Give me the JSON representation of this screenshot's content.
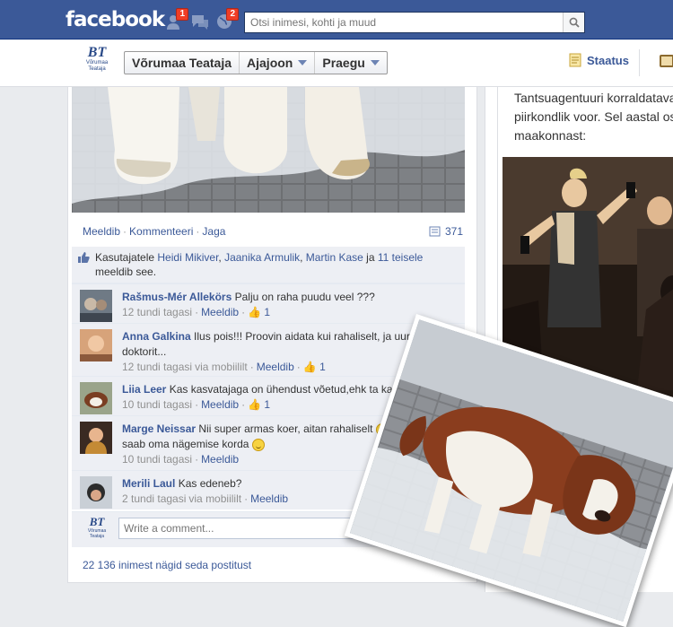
{
  "topbar": {
    "logo": "facebook",
    "friend_requests_badge": "1",
    "messages_badge": "",
    "notifications_badge": "2",
    "search_placeholder": "Otsi inimesi, kohti ja muud"
  },
  "page_header": {
    "logo_monogram": "BT",
    "logo_caption": "Võrumaa Teataja",
    "crumbs": [
      {
        "label": "Võrumaa Teataja"
      },
      {
        "label": "Ajajoon"
      },
      {
        "label": "Praegu"
      }
    ],
    "status_label": "Staatus"
  },
  "post": {
    "actions": {
      "like": "Meeldib",
      "comment": "Kommenteeri",
      "share": "Jaga",
      "share_count": "371"
    },
    "likes": {
      "prefix": "Kasutajatele",
      "names": [
        "Heidi Mikiver",
        "Jaanika Armulik",
        "Martin Kase"
      ],
      "and": "ja",
      "others": "11 teisele",
      "suffix": "meeldib see."
    },
    "comments": [
      {
        "name": "Rašmus-Mér Allekörs",
        "text": "Palju on raha puudu veel ???",
        "time": "12 tundi tagasi",
        "via": "",
        "like": "Meeldib",
        "likes": "1"
      },
      {
        "name": "Anna Galkina",
        "text": "Ilus pois!!! Proovin aidata kui rahaliselt, ja uurin doktorit...",
        "time": "12 tundi tagasi",
        "via": "via mobiililt",
        "like": "Meeldib",
        "likes": "1"
      },
      {
        "name": "Liia Leer",
        "text": "Kas kasvatajaga on ühendust võetud,ehk ta ka aitaks",
        "time": "10 tundi tagasi",
        "via": "",
        "like": "Meeldib",
        "likes": "1"
      },
      {
        "name": "Marge Neissar",
        "text1": "Nii super armas koer, aitan rahaliselt",
        "text2": "ja loodan et ta saab oma nägemise korda",
        "time": "10 tundi tagasi",
        "via": "",
        "like": "Meeldib",
        "likes": ""
      },
      {
        "name": "Merili Laul",
        "text": "Kas edeneb?",
        "time": "2 tundi tagasi",
        "via": "via mobiililt",
        "like": "Meeldib",
        "likes": ""
      }
    ],
    "write_placeholder": "Write a comment...",
    "seen_text": "22 136 inimest nägid seda postitust",
    "seen_right": "Ke"
  },
  "right_column": {
    "lines": [
      "Tantsuagentuuri korraldatava",
      "piirkondlik voor. Sel aastal osa",
      "maakonnast:"
    ]
  },
  "colors": {
    "brand": "#3b5998",
    "badge": "#f03d25"
  }
}
